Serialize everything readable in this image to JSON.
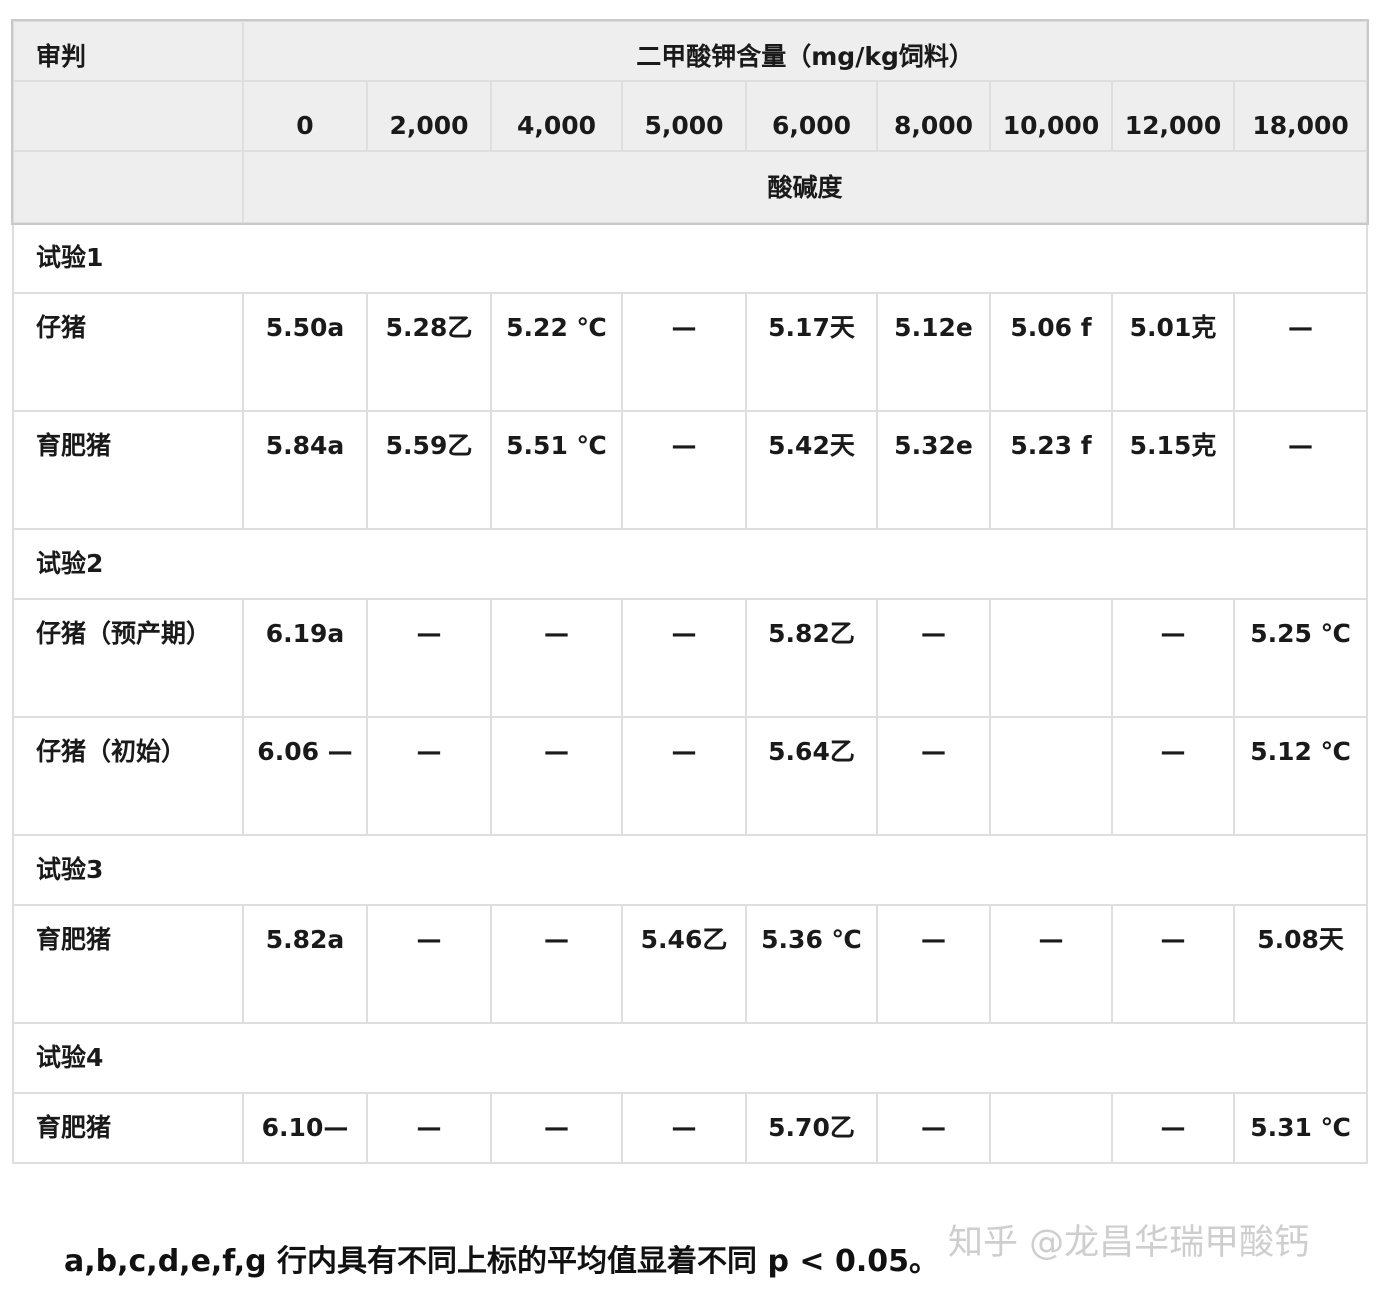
{
  "header": {
    "trial_label": "审判",
    "group_label": "二甲酸钾含量（mg/kg饲料）",
    "columns": [
      "0",
      "2,000",
      "4,000",
      "5,000",
      "6,000",
      "8,000",
      "10,000",
      "12,000",
      "18,000"
    ],
    "metric_label": "酸碱度"
  },
  "sections": [
    {
      "title": "试验1",
      "rows": [
        {
          "label": "仔猪",
          "values": [
            "5.50a",
            "5.28乙",
            "5.22 ℃",
            "—",
            "5.17天",
            "5.12e",
            "5.06 f",
            "5.01克",
            "—"
          ]
        },
        {
          "label": "育肥猪",
          "values": [
            "5.84a",
            "5.59乙",
            "5.51 ℃",
            "—",
            "5.42天",
            "5.32e",
            "5.23 f",
            "5.15克",
            "—"
          ]
        }
      ]
    },
    {
      "title": "试验2",
      "rows": [
        {
          "label": "仔猪（预产期）",
          "values": [
            "6.19a",
            "—",
            "—",
            "—",
            "5.82乙",
            "—",
            "",
            "—",
            "5.25 ℃"
          ]
        },
        {
          "label": "仔猪（初始）",
          "values": [
            "6.06 —",
            "—",
            "—",
            "—",
            "5.64乙",
            "—",
            "",
            "—",
            "5.12 ℃"
          ]
        }
      ]
    },
    {
      "title": "试验3",
      "rows": [
        {
          "label": "育肥猪",
          "values": [
            "5.82a",
            "—",
            "—",
            "5.46乙",
            "5.36 ℃",
            "—",
            "—",
            "—",
            "5.08天"
          ]
        }
      ]
    },
    {
      "title": "试验4",
      "rows": [
        {
          "label": "育肥猪",
          "values": [
            "6.10—",
            "—",
            "—",
            "—",
            "5.70乙",
            "—",
            "",
            "—",
            "5.31 ℃"
          ]
        }
      ]
    }
  ],
  "footnote": "a,b,c,d,e,f,g 行内具有不同上标的平均值显着不同 p < 0.05。",
  "watermark": "知乎 @龙昌华瑞甲酸钙"
}
